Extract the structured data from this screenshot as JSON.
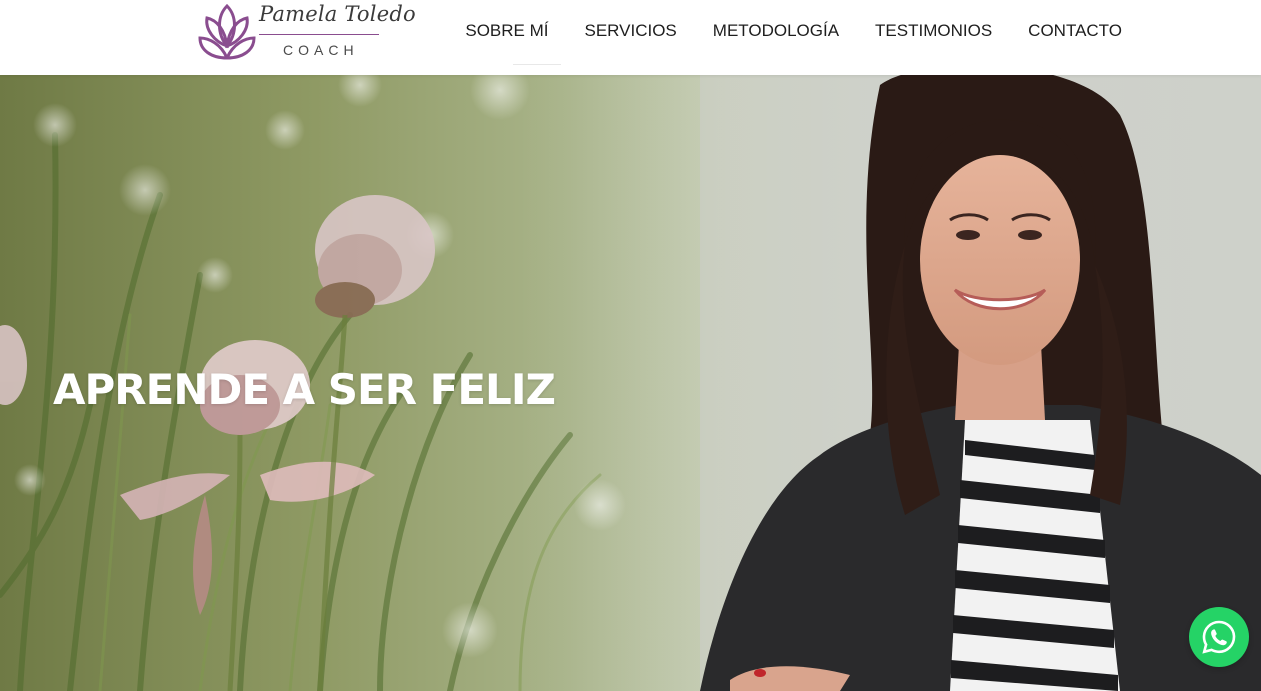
{
  "brand": {
    "name": "Pamela Toledo",
    "subtitle": "COACH",
    "accent_color": "#8a4d8f"
  },
  "nav": {
    "items": [
      {
        "label": "SOBRE MÍ"
      },
      {
        "label": "SERVICIOS"
      },
      {
        "label": "METODOLOGÍA"
      },
      {
        "label": "TESTIMONIOS"
      },
      {
        "label": "CONTACTO"
      }
    ]
  },
  "hero": {
    "title": "APRENDE A SER FELIZ"
  },
  "whatsapp": {
    "icon": "whatsapp-icon",
    "color": "#25d366"
  }
}
